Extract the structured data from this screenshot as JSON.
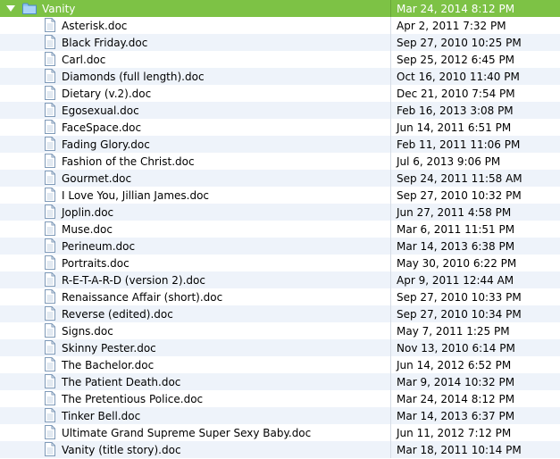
{
  "folder": {
    "name": "Vanity",
    "date": "Mar 24, 2014 8:12 PM",
    "icon": "folder-icon",
    "color": "#7dc245"
  },
  "files": [
    {
      "name": "Asterisk.doc",
      "date": "Apr 2, 2011 7:32 PM"
    },
    {
      "name": "Black Friday.doc",
      "date": "Sep 27, 2010 10:25 PM"
    },
    {
      "name": "Carl.doc",
      "date": "Sep 25, 2012 6:45 PM"
    },
    {
      "name": "Diamonds (full length).doc",
      "date": "Oct 16, 2010 11:40 PM"
    },
    {
      "name": "Dietary (v.2).doc",
      "date": "Dec 21, 2010 7:54 PM"
    },
    {
      "name": "Egosexual.doc",
      "date": "Feb 16, 2013 3:08 PM"
    },
    {
      "name": "FaceSpace.doc",
      "date": "Jun 14, 2011 6:51 PM"
    },
    {
      "name": "Fading Glory.doc",
      "date": "Feb 11, 2011 11:06 PM"
    },
    {
      "name": "Fashion of the Christ.doc",
      "date": "Jul 6, 2013 9:06 PM"
    },
    {
      "name": "Gourmet.doc",
      "date": "Sep 24, 2011 11:58 AM"
    },
    {
      "name": "I Love You, Jillian James.doc",
      "date": "Sep 27, 2010 10:32 PM"
    },
    {
      "name": "Joplin.doc",
      "date": "Jun 27, 2011 4:58 PM"
    },
    {
      "name": "Muse.doc",
      "date": "Mar 6, 2011 11:51 PM"
    },
    {
      "name": "Perineum.doc",
      "date": "Mar 14, 2013 6:38 PM"
    },
    {
      "name": "Portraits.doc",
      "date": "May 30, 2010 6:22 PM"
    },
    {
      "name": "R-E-T-A-R-D (version 2).doc",
      "date": "Apr 9, 2011 12:44 AM"
    },
    {
      "name": "Renaissance Affair (short).doc",
      "date": "Sep 27, 2010 10:33 PM"
    },
    {
      "name": "Reverse (edited).doc",
      "date": "Sep 27, 2010 10:34 PM"
    },
    {
      "name": "Signs.doc",
      "date": "May 7, 2011 1:25 PM"
    },
    {
      "name": "Skinny Pester.doc",
      "date": "Nov 13, 2010 6:14 PM"
    },
    {
      "name": "The Bachelor.doc",
      "date": "Jun 14, 2012 6:52 PM"
    },
    {
      "name": "The Patient Death.doc",
      "date": "Mar 9, 2014 10:32 PM"
    },
    {
      "name": "The Pretentious Police.doc",
      "date": "Mar 24, 2014 8:12 PM"
    },
    {
      "name": "Tinker Bell.doc",
      "date": "Mar 14, 2013 6:37 PM"
    },
    {
      "name": "Ultimate Grand Supreme Super Sexy Baby.doc",
      "date": "Jun 11, 2012 7:12 PM"
    },
    {
      "name": "Vanity (title story).doc",
      "date": "Mar 18, 2011 10:14 PM"
    }
  ],
  "icons": {
    "disclosure": "disclosure-triangle-icon",
    "file": "document-icon"
  },
  "colors": {
    "selected_row": "#7dc245",
    "alt_row": "#eef3fa",
    "selected_text": "#ffffff"
  }
}
